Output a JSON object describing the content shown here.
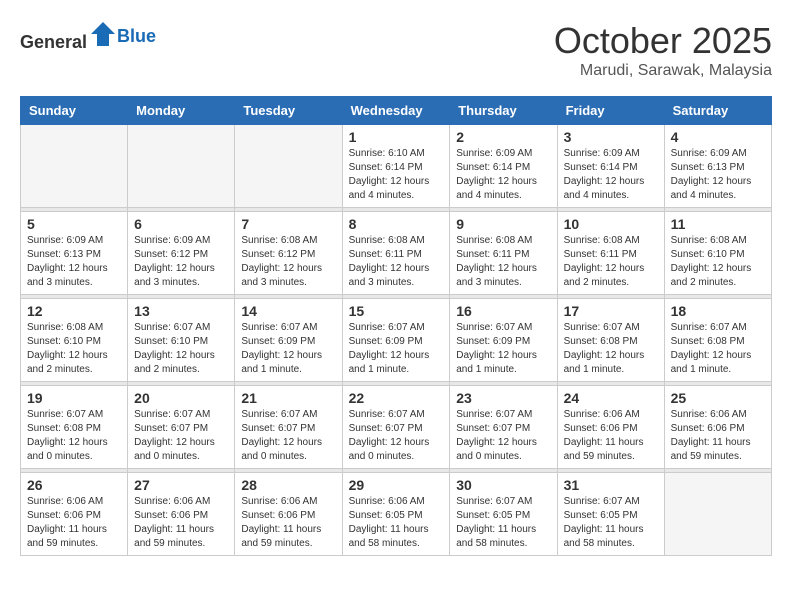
{
  "header": {
    "logo_general": "General",
    "logo_blue": "Blue",
    "month": "October 2025",
    "location": "Marudi, Sarawak, Malaysia"
  },
  "weekdays": [
    "Sunday",
    "Monday",
    "Tuesday",
    "Wednesday",
    "Thursday",
    "Friday",
    "Saturday"
  ],
  "weeks": [
    [
      {
        "day": "",
        "info": ""
      },
      {
        "day": "",
        "info": ""
      },
      {
        "day": "",
        "info": ""
      },
      {
        "day": "1",
        "info": "Sunrise: 6:10 AM\nSunset: 6:14 PM\nDaylight: 12 hours\nand 4 minutes."
      },
      {
        "day": "2",
        "info": "Sunrise: 6:09 AM\nSunset: 6:14 PM\nDaylight: 12 hours\nand 4 minutes."
      },
      {
        "day": "3",
        "info": "Sunrise: 6:09 AM\nSunset: 6:14 PM\nDaylight: 12 hours\nand 4 minutes."
      },
      {
        "day": "4",
        "info": "Sunrise: 6:09 AM\nSunset: 6:13 PM\nDaylight: 12 hours\nand 4 minutes."
      }
    ],
    [
      {
        "day": "5",
        "info": "Sunrise: 6:09 AM\nSunset: 6:13 PM\nDaylight: 12 hours\nand 3 minutes."
      },
      {
        "day": "6",
        "info": "Sunrise: 6:09 AM\nSunset: 6:12 PM\nDaylight: 12 hours\nand 3 minutes."
      },
      {
        "day": "7",
        "info": "Sunrise: 6:08 AM\nSunset: 6:12 PM\nDaylight: 12 hours\nand 3 minutes."
      },
      {
        "day": "8",
        "info": "Sunrise: 6:08 AM\nSunset: 6:11 PM\nDaylight: 12 hours\nand 3 minutes."
      },
      {
        "day": "9",
        "info": "Sunrise: 6:08 AM\nSunset: 6:11 PM\nDaylight: 12 hours\nand 3 minutes."
      },
      {
        "day": "10",
        "info": "Sunrise: 6:08 AM\nSunset: 6:11 PM\nDaylight: 12 hours\nand 2 minutes."
      },
      {
        "day": "11",
        "info": "Sunrise: 6:08 AM\nSunset: 6:10 PM\nDaylight: 12 hours\nand 2 minutes."
      }
    ],
    [
      {
        "day": "12",
        "info": "Sunrise: 6:08 AM\nSunset: 6:10 PM\nDaylight: 12 hours\nand 2 minutes."
      },
      {
        "day": "13",
        "info": "Sunrise: 6:07 AM\nSunset: 6:10 PM\nDaylight: 12 hours\nand 2 minutes."
      },
      {
        "day": "14",
        "info": "Sunrise: 6:07 AM\nSunset: 6:09 PM\nDaylight: 12 hours\nand 1 minute."
      },
      {
        "day": "15",
        "info": "Sunrise: 6:07 AM\nSunset: 6:09 PM\nDaylight: 12 hours\nand 1 minute."
      },
      {
        "day": "16",
        "info": "Sunrise: 6:07 AM\nSunset: 6:09 PM\nDaylight: 12 hours\nand 1 minute."
      },
      {
        "day": "17",
        "info": "Sunrise: 6:07 AM\nSunset: 6:08 PM\nDaylight: 12 hours\nand 1 minute."
      },
      {
        "day": "18",
        "info": "Sunrise: 6:07 AM\nSunset: 6:08 PM\nDaylight: 12 hours\nand 1 minute."
      }
    ],
    [
      {
        "day": "19",
        "info": "Sunrise: 6:07 AM\nSunset: 6:08 PM\nDaylight: 12 hours\nand 0 minutes."
      },
      {
        "day": "20",
        "info": "Sunrise: 6:07 AM\nSunset: 6:07 PM\nDaylight: 12 hours\nand 0 minutes."
      },
      {
        "day": "21",
        "info": "Sunrise: 6:07 AM\nSunset: 6:07 PM\nDaylight: 12 hours\nand 0 minutes."
      },
      {
        "day": "22",
        "info": "Sunrise: 6:07 AM\nSunset: 6:07 PM\nDaylight: 12 hours\nand 0 minutes."
      },
      {
        "day": "23",
        "info": "Sunrise: 6:07 AM\nSunset: 6:07 PM\nDaylight: 12 hours\nand 0 minutes."
      },
      {
        "day": "24",
        "info": "Sunrise: 6:06 AM\nSunset: 6:06 PM\nDaylight: 11 hours\nand 59 minutes."
      },
      {
        "day": "25",
        "info": "Sunrise: 6:06 AM\nSunset: 6:06 PM\nDaylight: 11 hours\nand 59 minutes."
      }
    ],
    [
      {
        "day": "26",
        "info": "Sunrise: 6:06 AM\nSunset: 6:06 PM\nDaylight: 11 hours\nand 59 minutes."
      },
      {
        "day": "27",
        "info": "Sunrise: 6:06 AM\nSunset: 6:06 PM\nDaylight: 11 hours\nand 59 minutes."
      },
      {
        "day": "28",
        "info": "Sunrise: 6:06 AM\nSunset: 6:06 PM\nDaylight: 11 hours\nand 59 minutes."
      },
      {
        "day": "29",
        "info": "Sunrise: 6:06 AM\nSunset: 6:05 PM\nDaylight: 11 hours\nand 58 minutes."
      },
      {
        "day": "30",
        "info": "Sunrise: 6:07 AM\nSunset: 6:05 PM\nDaylight: 11 hours\nand 58 minutes."
      },
      {
        "day": "31",
        "info": "Sunrise: 6:07 AM\nSunset: 6:05 PM\nDaylight: 11 hours\nand 58 minutes."
      },
      {
        "day": "",
        "info": ""
      }
    ]
  ]
}
